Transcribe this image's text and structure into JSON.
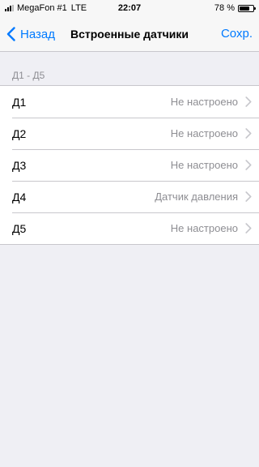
{
  "status_bar": {
    "carrier": "MegaFon #1",
    "network": "LTE",
    "time": "22:07",
    "battery_text": "78 %",
    "battery_level": 0.78,
    "signal_bars": 3
  },
  "nav": {
    "back_label": "Назад",
    "title": "Встроенные датчики",
    "save_label": "Сохр."
  },
  "section": {
    "header": "Д1 - Д5"
  },
  "rows": [
    {
      "label": "Д1",
      "value": "Не настроено"
    },
    {
      "label": "Д2",
      "value": "Не настроено"
    },
    {
      "label": "Д3",
      "value": "Не настроено"
    },
    {
      "label": "Д4",
      "value": "Датчик давления"
    },
    {
      "label": "Д5",
      "value": "Не настроено"
    }
  ],
  "colors": {
    "accent": "#007aff",
    "background": "#efeff4",
    "secondary_text": "#8e8e93",
    "separator": "#c8c7cc"
  }
}
